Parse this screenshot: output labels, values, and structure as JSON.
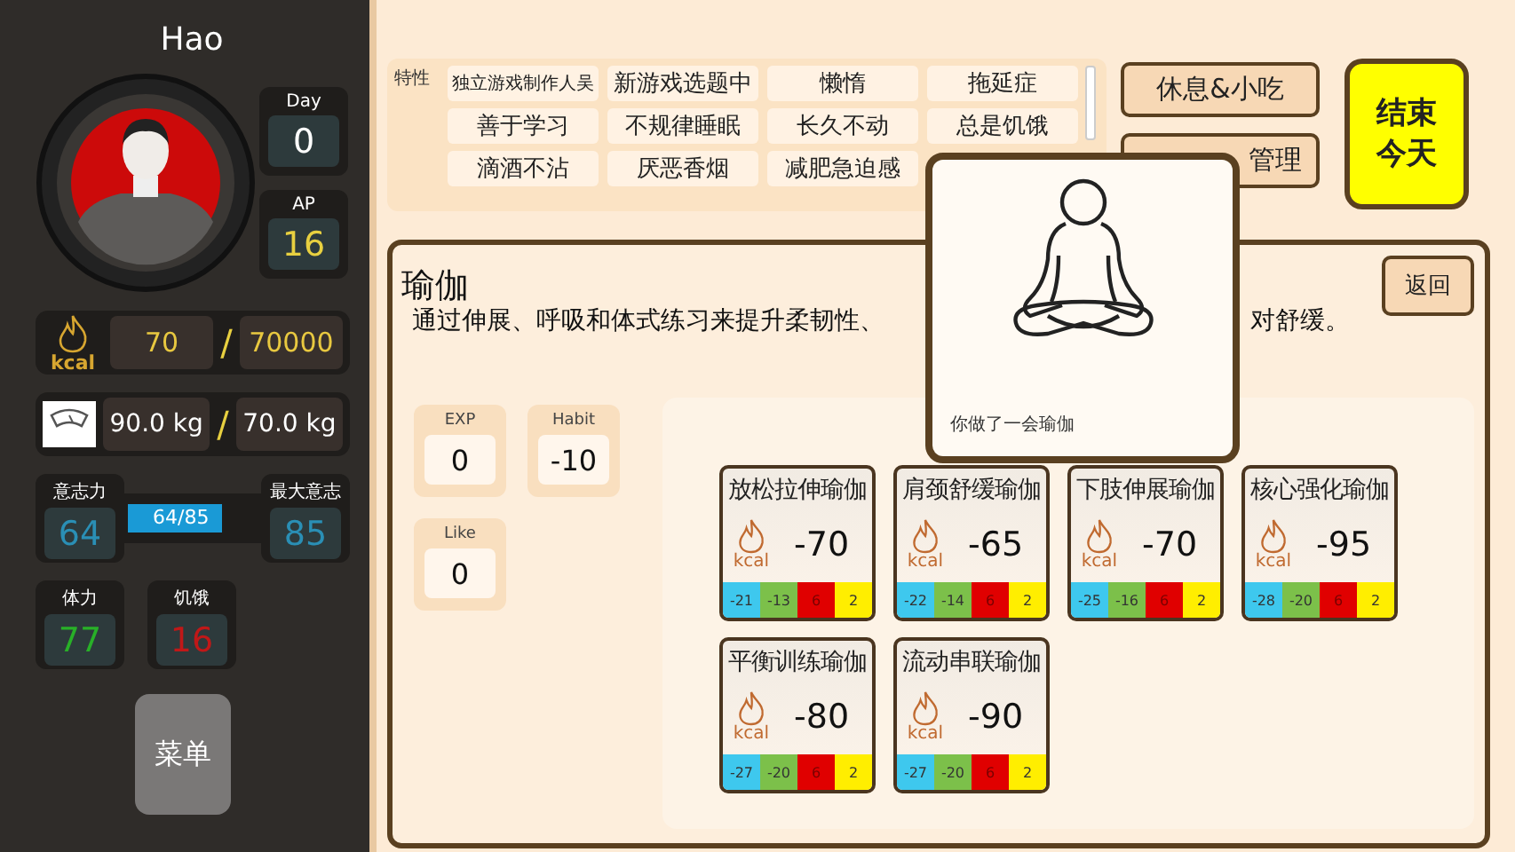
{
  "player": {
    "name": "Hao",
    "day_label": "Day",
    "day": "0",
    "ap_label": "AP",
    "ap": "16"
  },
  "calories": {
    "unit": "kcal",
    "current": "70",
    "separator": "/",
    "target": "70000"
  },
  "weight": {
    "current": "90.0 kg",
    "separator": "/",
    "target": "70.0 kg"
  },
  "willpower": {
    "label": "意志力",
    "value": "64",
    "bar_text": "64/85",
    "level": 0.75,
    "max_label": "最大意志",
    "max": "85"
  },
  "stamina": {
    "label": "体力",
    "value": "77"
  },
  "hunger": {
    "label": "饥饿",
    "value": "16"
  },
  "menu_button": "菜单",
  "traits": {
    "label": "特性",
    "items": [
      "独立游戏制作人吴",
      "新游戏选题中",
      "懒惰",
      "拖延症",
      "善于学习",
      "不规律睡眠",
      "长久不动",
      "总是饥饿",
      "滴酒不沾",
      "厌恶香烟",
      "减肥急迫感"
    ]
  },
  "buttons": [
    "休息&小吃",
    "管理"
  ],
  "end_day_button": [
    "结束",
    "今天"
  ],
  "activity": {
    "title": "瑜伽",
    "description_start": "通过伸展、呼吸和体式练习来提升柔韧性、",
    "description_end": "对舒缓。",
    "back_button": "返回",
    "stats": [
      {
        "label": "EXP",
        "value": "0"
      },
      {
        "label": "Habit",
        "value": "-10"
      },
      {
        "label": "Like",
        "value": "0"
      }
    ],
    "cards": [
      {
        "name": "放松拉伸瑜伽",
        "unit": "kcal",
        "value": "-70",
        "cells": [
          {
            "value": "-21",
            "color": "#3ec8ee"
          },
          {
            "value": "-13",
            "color": "#7cc04a"
          },
          {
            "value": "6",
            "color": "#e00000"
          },
          {
            "value": "2",
            "color": "#ffee00"
          }
        ]
      },
      {
        "name": "肩颈舒缓瑜伽",
        "unit": "kcal",
        "value": "-65",
        "cells": [
          {
            "value": "-22",
            "color": "#3ec8ee"
          },
          {
            "value": "-14",
            "color": "#7cc04a"
          },
          {
            "value": "6",
            "color": "#e00000"
          },
          {
            "value": "2",
            "color": "#ffee00"
          }
        ]
      },
      {
        "name": "下肢伸展瑜伽",
        "unit": "kcal",
        "value": "-70",
        "cells": [
          {
            "value": "-25",
            "color": "#3ec8ee"
          },
          {
            "value": "-16",
            "color": "#7cc04a"
          },
          {
            "value": "6",
            "color": "#e00000"
          },
          {
            "value": "2",
            "color": "#ffee00"
          }
        ]
      },
      {
        "name": "核心强化瑜伽",
        "unit": "kcal",
        "value": "-95",
        "cells": [
          {
            "value": "-28",
            "color": "#3ec8ee"
          },
          {
            "value": "-20",
            "color": "#7cc04a"
          },
          {
            "value": "6",
            "color": "#e00000"
          },
          {
            "value": "2",
            "color": "#ffee00"
          }
        ]
      },
      {
        "name": "平衡训练瑜伽",
        "unit": "kcal",
        "value": "-80",
        "cells": [
          {
            "value": "-27",
            "color": "#3ec8ee"
          },
          {
            "value": "-20",
            "color": "#7cc04a"
          },
          {
            "value": "6",
            "color": "#e00000"
          },
          {
            "value": "2",
            "color": "#ffee00"
          }
        ]
      },
      {
        "name": "流动串联瑜伽",
        "unit": "kcal",
        "value": "-90",
        "cells": [
          {
            "value": "-27",
            "color": "#3ec8ee"
          },
          {
            "value": "-20",
            "color": "#7cc04a"
          },
          {
            "value": "6",
            "color": "#e00000"
          },
          {
            "value": "2",
            "color": "#ffee00"
          }
        ]
      }
    ]
  },
  "popup": {
    "message": "你做了一会瑜伽"
  }
}
